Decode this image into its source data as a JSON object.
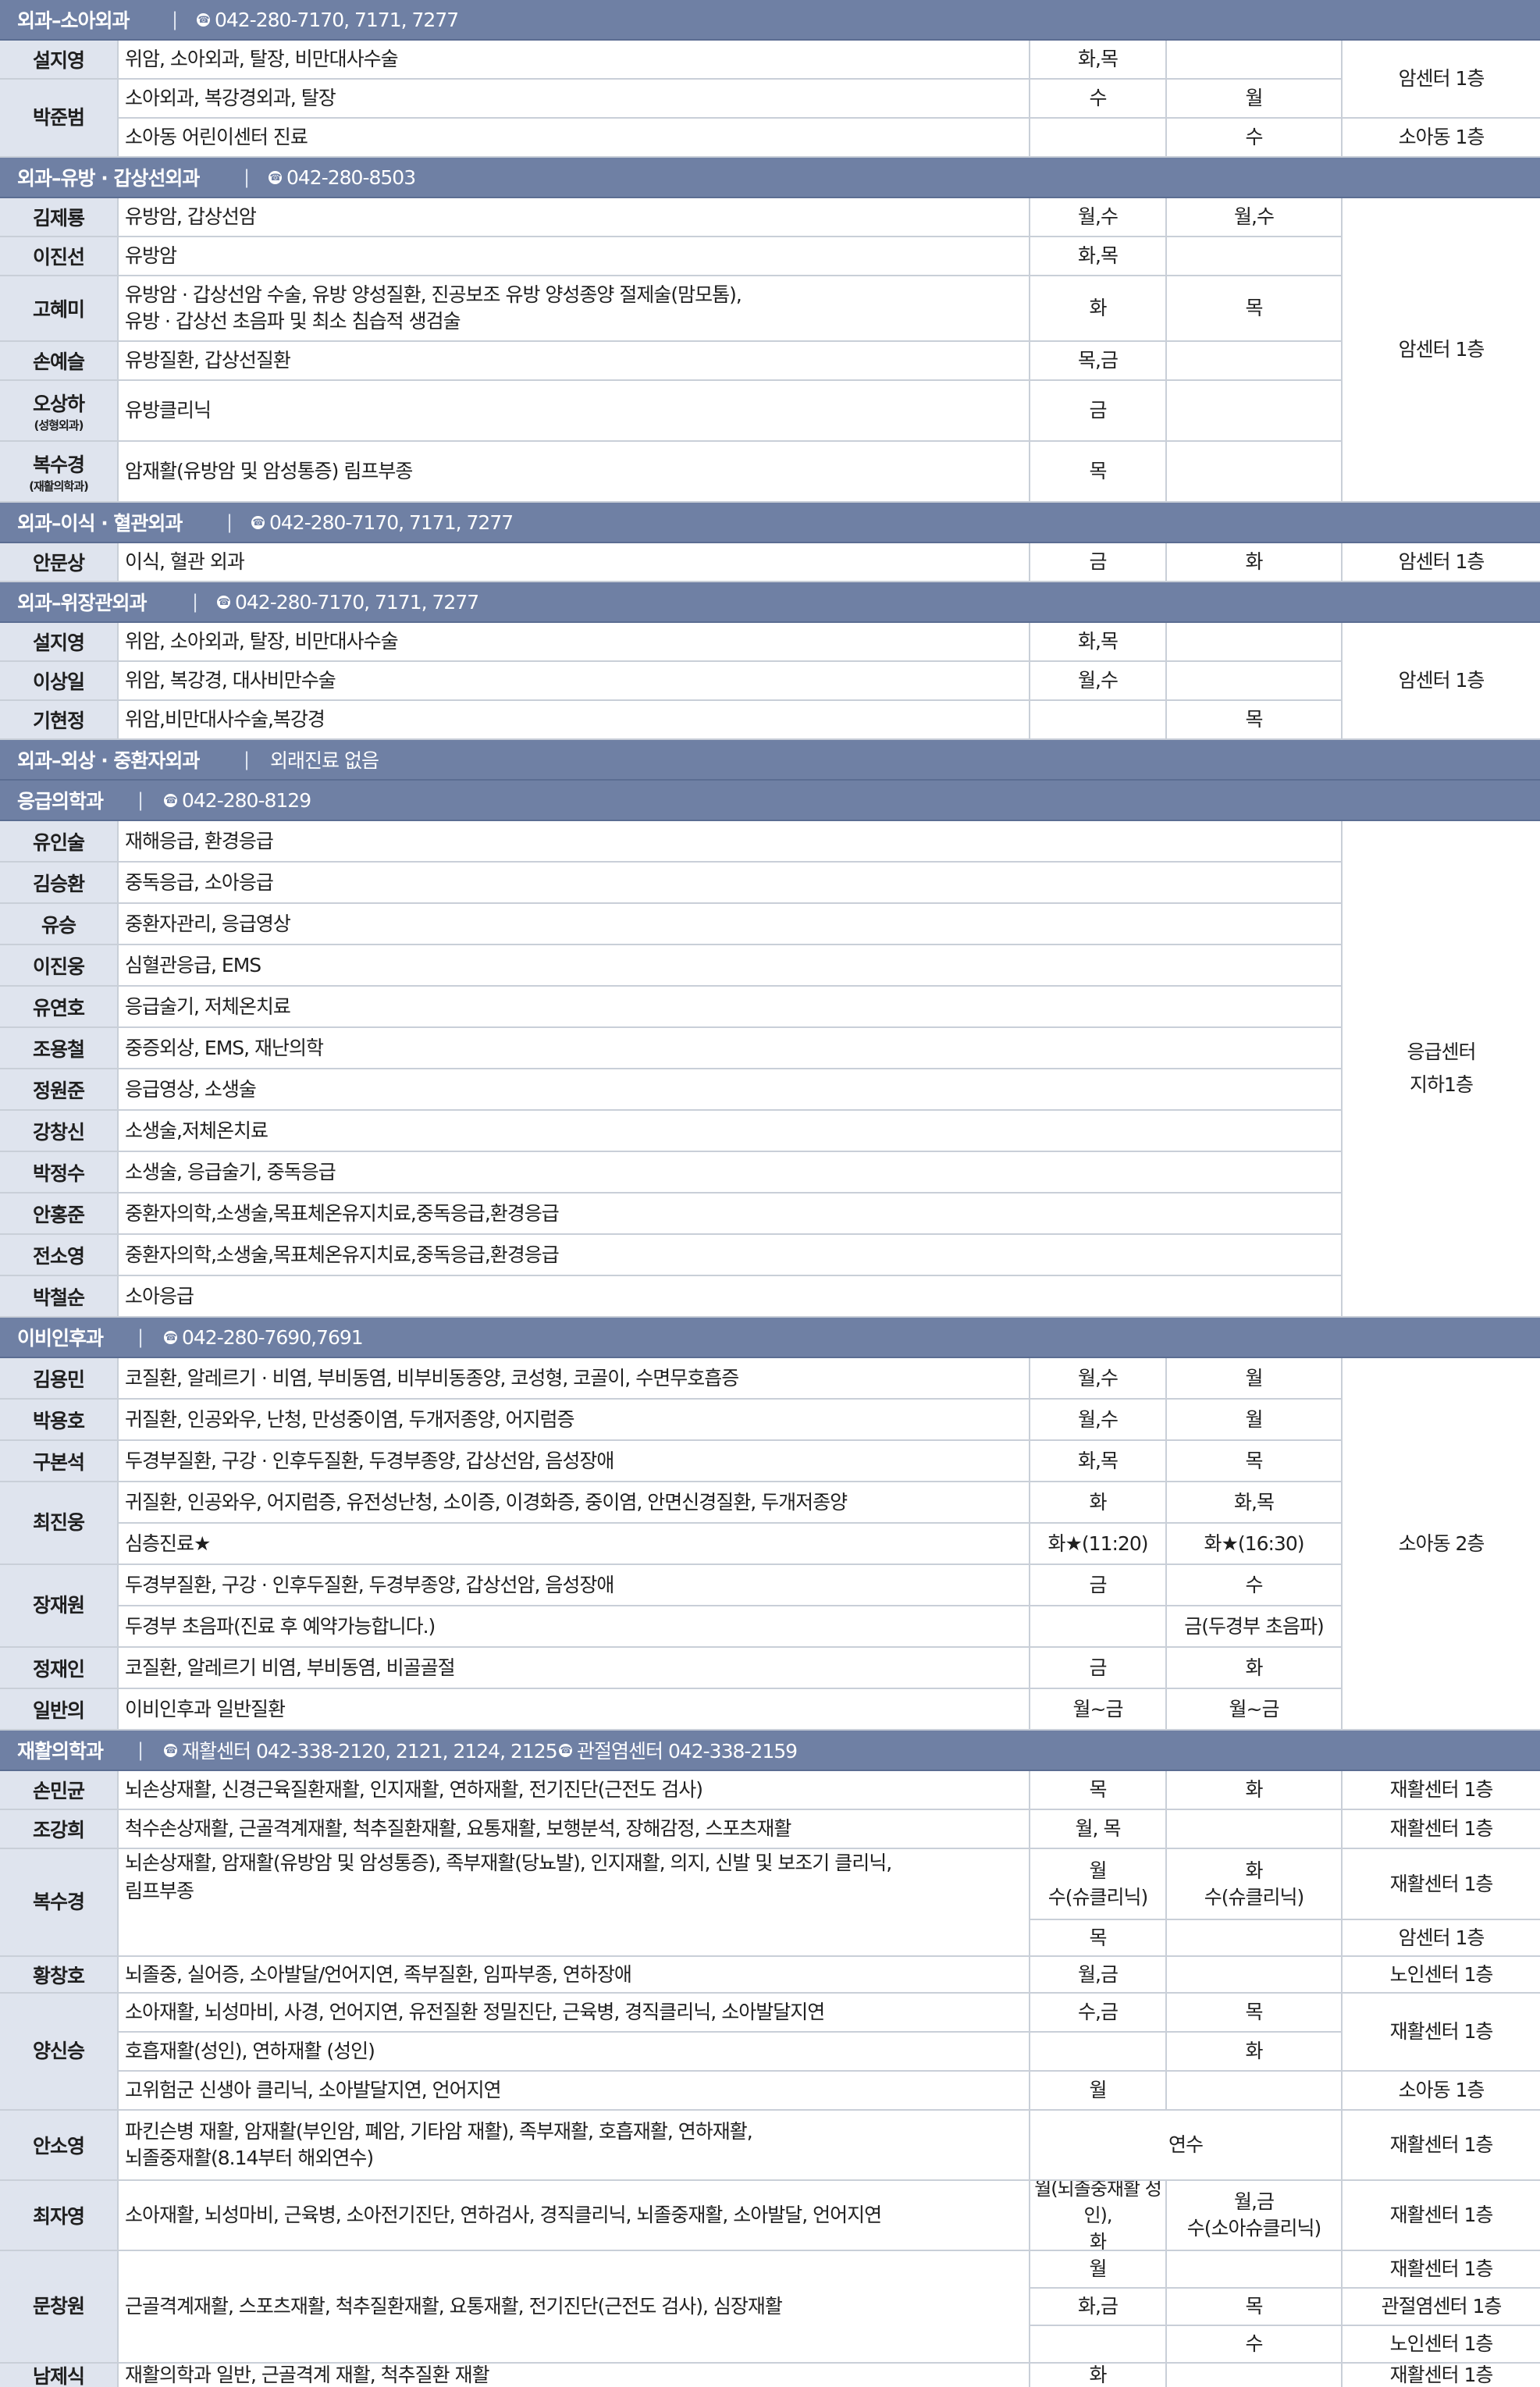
{
  "sections": [
    {
      "header": {
        "title": "외과–소아외과",
        "phone": "042-280-7170, 7171, 7277"
      },
      "rows": [
        {
          "name": "설지영",
          "desc": "위암, 소아외과, 탈장, 비만대사수술",
          "am": "화,목",
          "pm": ""
        },
        {
          "name": "박준범",
          "desc": "소아외과, 복강경외과, 탈장",
          "am": "수",
          "pm": "월"
        },
        {
          "name": "",
          "desc": "소아동 어린이센터 진료",
          "am": "",
          "pm": "수"
        }
      ],
      "locations": [
        "암센터 1층",
        "소아동 1층"
      ]
    },
    {
      "header": {
        "title": "외과–유방 · 갑상선외과",
        "phone": "042-280-8503"
      },
      "rows": [
        {
          "name": "김제룡",
          "desc": "유방암, 갑상선암",
          "am": "월,수",
          "pm": "월,수"
        },
        {
          "name": "이진선",
          "desc": "유방암",
          "am": "화,목",
          "pm": ""
        },
        {
          "name": "고혜미",
          "desc": "유방암 · 갑상선암 수술, 유방 양성질환, 진공보조 유방 양성종양 절제술(맘모톰),",
          "desc2": "유방 · 갑상선 초음파 및 최소 침습적 생검술",
          "am": "화",
          "pm": "목"
        },
        {
          "name": "손예슬",
          "desc": "유방질환, 갑상선질환",
          "am": "목,금",
          "pm": ""
        },
        {
          "name": "오상하",
          "sub": "(성형외과)",
          "desc": "유방클리닉",
          "am": "금",
          "pm": ""
        },
        {
          "name": "복수경",
          "sub": "(재활의학과)",
          "desc": "암재활(유방암 및 암성통증) 림프부종",
          "am": "목",
          "pm": ""
        }
      ],
      "locations": [
        "암센터 1층"
      ]
    },
    {
      "header": {
        "title": "외과–이식 · 혈관외과",
        "phone": "042-280-7170, 7171, 7277"
      },
      "rows": [
        {
          "name": "안문상",
          "desc": "이식, 혈관 외과",
          "am": "금",
          "pm": "화",
          "loc": "암센터 1층"
        }
      ]
    },
    {
      "header": {
        "title": "외과–위장관외과",
        "phone": "042-280-7170, 7171, 7277"
      },
      "rows": [
        {
          "name": "설지영",
          "desc": "위암, 소아외과, 탈장, 비만대사수술",
          "am": "화,목",
          "pm": ""
        },
        {
          "name": "이상일",
          "desc": "위암, 복강경, 대사비만수술",
          "am": "월,수",
          "pm": ""
        },
        {
          "name": "기현정",
          "desc": "위암,비만대사수술,복강경",
          "am": "",
          "pm": "목"
        }
      ],
      "locations": [
        "암센터 1층"
      ]
    },
    {
      "header": {
        "title": "외과–외상 · 중환자외과",
        "note": "외래진료 없음"
      }
    },
    {
      "header": {
        "title": "응급의학과",
        "phone": "042-280-8129"
      },
      "rows": [
        {
          "name": "유인술",
          "desc": "재해응급, 환경응급"
        },
        {
          "name": "김승환",
          "desc": "중독응급, 소아응급"
        },
        {
          "name": "유승",
          "desc": "중환자관리, 응급영상"
        },
        {
          "name": "이진웅",
          "desc": "심혈관응급, EMS"
        },
        {
          "name": "유연호",
          "desc": "응급술기, 저체온치료"
        },
        {
          "name": "조용철",
          "desc": "중증외상, EMS, 재난의학"
        },
        {
          "name": "정원준",
          "desc": "응급영상, 소생술"
        },
        {
          "name": "강창신",
          "desc": "소생술,저체온치료"
        },
        {
          "name": "박정수",
          "desc": "소생술, 응급술기, 중독응급"
        },
        {
          "name": "안홍준",
          "desc": "중환자의학,소생술,목표체온유지치료,중독응급,환경응급"
        },
        {
          "name": "전소영",
          "desc": "중환자의학,소생술,목표체온유지치료,중독응급,환경응급"
        },
        {
          "name": "박철순",
          "desc": "소아응급"
        }
      ],
      "locations": [
        "응급센터",
        "지하1층"
      ]
    },
    {
      "header": {
        "title": "이비인후과",
        "phone": "042-280-7690,7691"
      },
      "rows": [
        {
          "name": "김용민",
          "desc": "코질환, 알레르기 · 비염, 부비동염, 비부비동종양, 코성형, 코골이, 수면무호흡증",
          "am": "월,수",
          "pm": "월"
        },
        {
          "name": "박용호",
          "desc": "귀질환, 인공와우, 난청, 만성중이염, 두개저종양, 어지럼증",
          "am": "월,수",
          "pm": "월"
        },
        {
          "name": "구본석",
          "desc": "두경부질환, 구강 · 인후두질환, 두경부종양, 갑상선암, 음성장애",
          "am": "화,목",
          "pm": "목"
        },
        {
          "name": "최진웅",
          "desc": "귀질환, 인공와우, 어지럼증, 유전성난청, 소이증, 이경화증, 중이염, 안면신경질환, 두개저종양",
          "am": "화",
          "pm": "화,목"
        },
        {
          "name": "",
          "desc": "심층진료★",
          "am": "화★(11:20)",
          "pm": "화★(16:30)"
        },
        {
          "name": "장재원",
          "desc": "두경부질환, 구강 · 인후두질환, 두경부종양, 갑상선암, 음성장애",
          "am": "금",
          "pm": "수"
        },
        {
          "name": "",
          "desc": "두경부 초음파(진료 후 예약가능합니다.)",
          "am": "",
          "pm": "금(두경부 초음파)"
        },
        {
          "name": "정재인",
          "desc": "코질환, 알레르기 비염, 부비동염, 비골골절",
          "am": "금",
          "pm": "화"
        },
        {
          "name": "일반의",
          "desc": "이비인후과 일반질환",
          "am": "월~금",
          "pm": "월~금"
        }
      ],
      "locations": [
        "소아동 2층"
      ]
    },
    {
      "header": {
        "title": "재활의학과",
        "phone": "재활센터 042-338-2120, 2121, 2124, 2125",
        "phone2": "관절염센터 042-338-2159"
      },
      "rows": [
        {
          "name": "손민균",
          "desc": "뇌손상재활, 신경근육질환재활, 인지재활, 연하재활, 전기진단(근전도 검사)",
          "am": "목",
          "pm": "화",
          "loc": "재활센터 1층"
        },
        {
          "name": "조강희",
          "desc": "척수손상재활, 근골격계재활, 척추질환재활, 요통재활, 보행분석, 장해감정, 스포츠재활",
          "am": "월, 목",
          "pm": "",
          "loc": "재활센터 1층"
        },
        {
          "name": "복수경",
          "desc": "뇌손상재활, 암재활(유방암 및 암성통증), 족부재활(당뇨발), 인지재활, 의지, 신발 및 보조기 클리닉,",
          "desc2": "림프부종",
          "am": "월",
          "am2": "수(슈클리닉)",
          "pm": "화",
          "pm2": "수(슈클리닉)",
          "loc": "재활센터 1층",
          "am3": "목",
          "loc2": "암센터 1층"
        },
        {
          "name": "황창호",
          "desc": "뇌졸중, 실어증, 소아발달/언어지연, 족부질환, 임파부종, 연하장애",
          "am": "월,금",
          "pm": "",
          "loc": "노인센터 1층"
        },
        {
          "name": "양신승",
          "desc": "소아재활, 뇌성마비, 사경, 언어지연,  유전질환 정밀진단, 근육병, 경직클리닉, 소아발달지연",
          "am": "수,금",
          "pm": "목",
          "loc": "재활센터 1층"
        },
        {
          "name": "",
          "desc": "호흡재활(성인), 연하재활 (성인)",
          "am": "",
          "pm": "화"
        },
        {
          "name": "",
          "desc": "고위험군 신생아 클리닉, 소아발달지연, 언어지연",
          "am": "월",
          "pm": "",
          "loc": "소아동 1층"
        },
        {
          "name": "안소영",
          "desc": "파킨슨병 재활, 암재활(부인암, 폐암, 기타암 재활), 족부재활, 호흡재활, 연하재활,",
          "desc2": "뇌졸중재활(8.14부터 해외연수)",
          "ampm": "연수",
          "loc": "재활센터 1층"
        },
        {
          "name": "최자영",
          "desc": "소아재활, 뇌성마비, 근육병, 소아전기진단, 연하검사, 경직클리닉, 뇌졸중재활, 소아발달, 언어지연",
          "am": "월(뇌졸중재활 성인),",
          "am2": "화",
          "pm": "월,금",
          "pm2": "수(소아슈클리닉)",
          "loc": "재활센터 1층"
        },
        {
          "name": "문창원",
          "desc": "근골격계재활, 스포츠재활, 척추질환재활, 요통재활, 전기진단(근전도 검사), 심장재활",
          "am": "월",
          "am2": "화,금",
          "pm": "",
          "pm2": "목",
          "pm3": "수",
          "loc": "재활센터 1층",
          "loc2": "관절염센터 1층",
          "loc3": "노인센터 1층"
        },
        {
          "name": "남제식",
          "desc": "재활의학과 일반, 근골격계 재활, 척추질환 재활",
          "am": "화",
          "pm": "",
          "loc": "재활센터 1층"
        }
      ]
    }
  ],
  "colors": {
    "header_bg": "#6f80a4",
    "name_bg": "#dfe4ee",
    "grid": "#c9cfd8"
  },
  "icons": {
    "phone": "phone-icon"
  }
}
